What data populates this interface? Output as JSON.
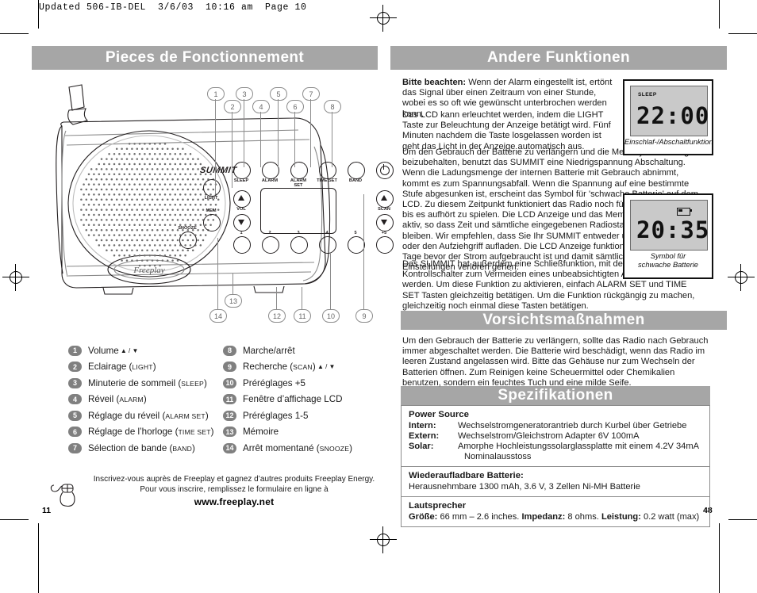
{
  "prepress": {
    "header": "Updated 506-IB-DEL  3/6/03  10:16 am  Page 10"
  },
  "page_numbers": {
    "left": "11",
    "right": "48"
  },
  "left_column": {
    "banner_title": "Pieces de Fonctionnement",
    "device": {
      "brand": "SUMMIT",
      "logo": "Freeplay",
      "buttons": {
        "sleep": "SLEEP",
        "alarm": "ALARM",
        "alarm_set": "ALARM SET",
        "time_set": "TIME SET",
        "band": "BAND",
        "light": "LIGHT",
        "vol": "VOL",
        "scan": "SCAN",
        "mem": "MEM",
        "snooze": "SNOOZE",
        "preset_plus5": "+5",
        "presets": [
          "1",
          "2",
          "3",
          "4",
          "5"
        ]
      }
    },
    "callouts_top": [
      "1",
      "2",
      "3",
      "4",
      "5",
      "6",
      "7",
      "8"
    ],
    "callouts_bottom": [
      "13",
      "14",
      "12",
      "11",
      "10",
      "9"
    ],
    "legend_left": [
      {
        "num": "1",
        "text": "Volume",
        "suffix_arrows": true,
        "small": ""
      },
      {
        "num": "2",
        "text": "Eclairage (",
        "small": "LIGHT",
        "close": ")"
      },
      {
        "num": "3",
        "text": "Minuterie de sommeil (",
        "small": "SLEEP",
        "close": ")"
      },
      {
        "num": "4",
        "text": "Réveil (",
        "small": "ALARM",
        "close": ")"
      },
      {
        "num": "5",
        "text": "Réglage du réveil (",
        "small": "ALARM SET",
        "close": ")"
      },
      {
        "num": "6",
        "text": "Réglage de l’horloge (",
        "small": "TIME SET",
        "close": ")"
      },
      {
        "num": "7",
        "text": "Sélection de bande (",
        "small": "BAND",
        "close": ")"
      }
    ],
    "legend_right": [
      {
        "num": "8",
        "text": "Marche/arrêt",
        "small": "",
        "close": ""
      },
      {
        "num": "9",
        "text": "Recherche (",
        "small": "SCAN",
        "close": ")",
        "suffix_arrows": true
      },
      {
        "num": "10",
        "text": "Préréglages +5",
        "small": "",
        "close": ""
      },
      {
        "num": "11",
        "text": "Fenêtre d’affichage LCD",
        "small": "",
        "close": ""
      },
      {
        "num": "12",
        "text": "Préréglages 1-5",
        "small": "",
        "close": ""
      },
      {
        "num": "13",
        "text": "Mémoire",
        "small": "",
        "close": ""
      },
      {
        "num": "14",
        "text": "Arrêt momentané (",
        "small": "SNOOZE",
        "close": ")"
      }
    ],
    "footer": {
      "line1": "Inscrivez-vous auprès de Freeplay et gagnez d’autres produits Freeplay Energy.",
      "line2": "Pour vous inscrire, remplissez le formulaire en ligne à",
      "url": "www.freeplay.net",
      "icon": "mouse-icon"
    }
  },
  "right_column": {
    "banner_andere": "Andere Funktionen",
    "banner_vorsicht": "Vorsichtsmaßnahmen",
    "banner_spezi": "Spezifikationen",
    "p1_bold": "Bitte beachten:",
    "p1": " Wenn der Alarm eingestellt ist, ertönt das Signal über einen Zeitraum von einer Stunde, wobei es so oft wie gewünscht unterbrochen werden kann.",
    "p2": "Das LCD kann erleuchtet werden, indem die LIGHT Taste zur Beleuchtung der Anzeige betätigt wird. Fünf Minuten nachdem die Taste losgelassen worden ist geht das Licht in der Anzeige automatisch aus.",
    "p3": "Um den Gebrauch der Batterie zu verlängern und die Memory Einstellungen beizubehalten, benutzt das SUMMIT eine Niedrigspannung Abschaltung. Wenn die Ladungsmenge der internen Batterie mit Gebrauch abnimmt, kommt es zum Spannungsabfall. Wenn die Spannung auf eine bestimmte Stufe abgesunken ist, erscheint das Symbol für 'schwache Batterie' auf dem LCD. Zu diesem Zeitpunkt funktioniert das Radio noch für ein paar Minuten bis es aufhört zu spielen. Die LCD Anzeige und das Memory bleiben jedoch aktiv, so dass Zeit und sämtliche eingegebenen Radiostationen erhalten bleiben. Wir empfehlen, dass Sie Ihr SUMMIT entweder über den Adapter oder den Aufziehgriff aufladen. Die LCD Anzeige funktioniert noch einige Tage bevor der Strom aufgebraucht ist und damit sämtliche Memory Einstellungen verloren gehen.",
    "p4": "Das SUMMIT hat außerdem eine Schließfunktion, mit der die Kontrollschalter zum Vermeiden eines unbeabsichtigten Anstellens blockiert werden. Um diese Funktion zu aktivieren, einfach ALARM SET und TIME SET Tasten gleichzeitig betätigen. Um die Funktion rückgängig zu machen, gleichzeitig noch einmal diese Tasten betätigen.",
    "vorsicht_body": "Um den Gebrauch der Batterie zu verlängern, sollte das Radio nach Gebrauch immer abgeschaltet werden. Die Batterie wird beschädigt, wenn das Radio im leeren Zustand angelassen wird. Bitte das Gehäuse nur zum Wechseln der Batterien öffnen. Zum Reinigen keine Scheuermittel oder Chemikalien benutzen, sondern ein feuchtes Tuch und eine milde Seife.",
    "lcd_sleep": {
      "tag": "SLEEP",
      "time": "22:00",
      "caption": "Einschlaf-/Abschaltfunktion"
    },
    "lcd_battery": {
      "icon": "low-battery-icon",
      "time": "20:35",
      "caption_line1": "Symbol für",
      "caption_line2": "schwache Batterie"
    },
    "spec": {
      "power_title": "Power Source",
      "rows": [
        {
          "key": "Intern:",
          "val": "Wechselstromgeneratorantrieb durch Kurbel über Getriebe"
        },
        {
          "key": "Extern:",
          "val": "Wechselstrom/Gleichstrom Adapter 6V 100mA"
        },
        {
          "key": "Solar:",
          "val": "Amorphe Hochleistungssolarglassplatte mit einem 4.2V 34mA"
        }
      ],
      "solar_cont": "Nominalausstoss",
      "battery_title": "Wiederaufladbare Batterie:",
      "battery_body": "Herausnehmbare 1300 mAh, 3.6 V, 3 Zellen Ni-MH Batterie",
      "speaker_title": "Lautsprecher",
      "speaker_size_key": "Größe:",
      "speaker_size_val": " 66 mm – 2.6 inches.  ",
      "speaker_imp_key": "Impedanz:",
      "speaker_imp_val": " 8 ohms.  ",
      "speaker_pow_key": "Leistung:",
      "speaker_pow_val": " 0.2 watt (max)"
    }
  },
  "colors": {
    "banner_gray": "#a6a6a6",
    "badge_gray": "#808080",
    "lcd_gray": "#c9c9c9"
  }
}
